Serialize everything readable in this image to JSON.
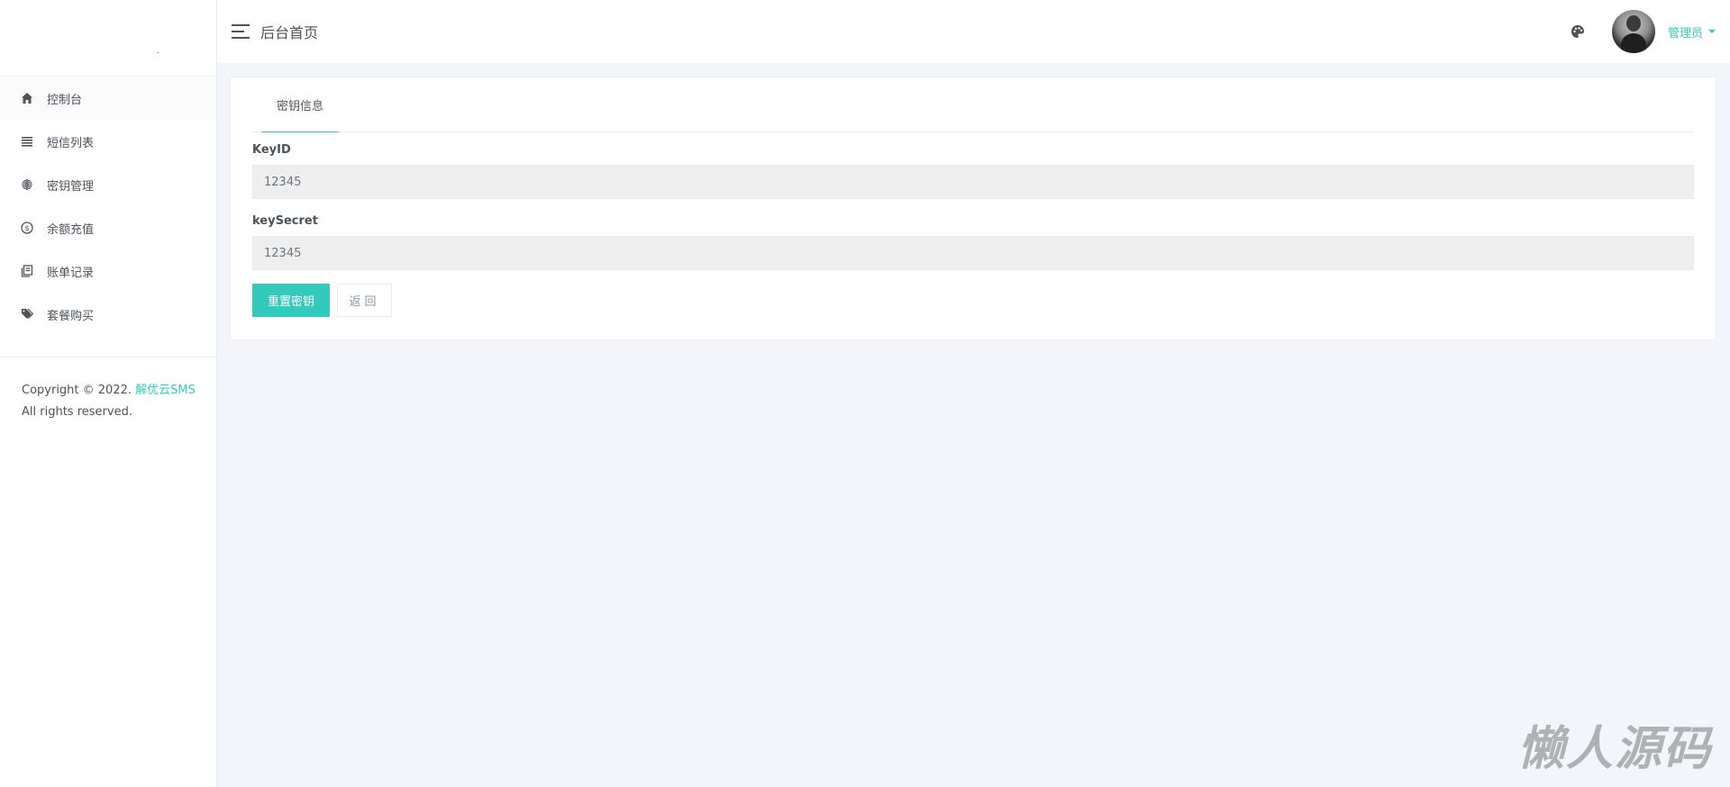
{
  "header": {
    "title": "后台首页",
    "user_name": "管理员"
  },
  "sidebar": {
    "items": [
      {
        "label": "控制台",
        "icon": "home-icon"
      },
      {
        "label": "短信列表",
        "icon": "list-icon"
      },
      {
        "label": "密钥管理",
        "icon": "fingerprint-icon"
      },
      {
        "label": "余额充值",
        "icon": "dollar-icon"
      },
      {
        "label": "账单记录",
        "icon": "ledger-icon"
      },
      {
        "label": "套餐购买",
        "icon": "tags-icon"
      }
    ],
    "copyright_prefix": "Copyright © 2022. ",
    "copyright_brand": "解优云SMS",
    "copyright_suffix": "All rights reserved."
  },
  "card": {
    "tab_label": "密钥信息",
    "fields": [
      {
        "label": "KeyID",
        "value": "12345"
      },
      {
        "label": "keySecret",
        "value": "12345"
      }
    ],
    "reset_button": "重置密钥",
    "back_button": "返回"
  },
  "watermark": "懒人源码",
  "colors": {
    "accent": "#33cabb",
    "background": "#f4f5fa",
    "input_bg": "#eeeeee"
  }
}
